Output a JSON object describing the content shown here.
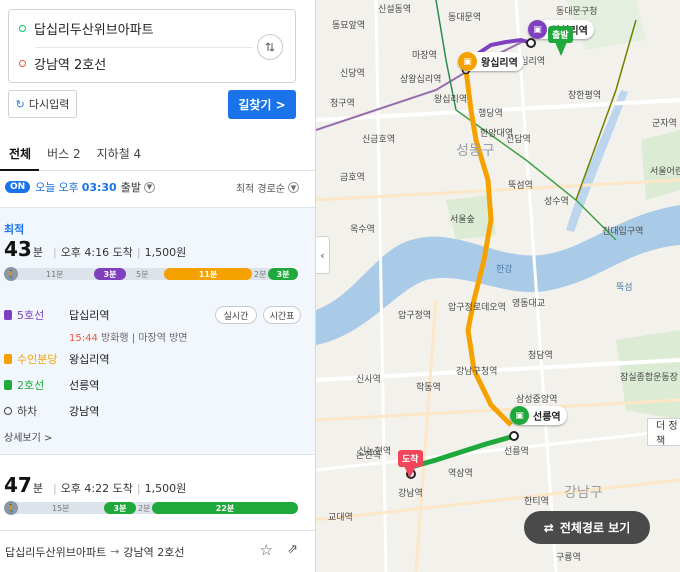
{
  "search": {
    "start": "답십리두산위브아파트",
    "end": "강남역 2호선"
  },
  "actions": {
    "reset_label": "다시입력",
    "go_label": "길찾기 >"
  },
  "tabs": [
    {
      "label": "전체"
    },
    {
      "label": "버스 2"
    },
    {
      "label": "지하철 4"
    }
  ],
  "timebar": {
    "on": "ON",
    "day": "오늘",
    "ampm": "오후",
    "time": "03:30",
    "suffix": "출발",
    "sort": "최적 경로순"
  },
  "route1": {
    "badge": "최적",
    "minutes": "43",
    "unit": "분",
    "arrival": "오후 4:16 도착",
    "fare": "1,500원",
    "segments": {
      "walk1": "11분",
      "bus": "3분",
      "walk2": "5분",
      "subway1": "11분",
      "walk3": "2분",
      "subway2": "3분"
    },
    "steps": [
      {
        "line": "5호선",
        "station": "답십리역"
      },
      {
        "line": "수인분당",
        "station": "왕십리역"
      },
      {
        "line": "2호선",
        "station": "선릉역"
      },
      {
        "line": "하차",
        "station": "강남역"
      }
    ],
    "sub_time": "15:44",
    "sub_info": " 방화행 | 마장역 방면",
    "btn_realtime": "실시간",
    "btn_timetable": "시간표",
    "detail": "상세보기 >"
  },
  "route2": {
    "minutes": "47",
    "unit": "분",
    "arrival": "오후 4:22 도착",
    "fare": "1,500원",
    "segments": {
      "walk1": "15분",
      "seg1": "3분",
      "walk2": "2분",
      "seg2": "22분"
    }
  },
  "footer": {
    "from": "답십리두산위브아파트",
    "arrow": "→",
    "to": "강남역 2호선"
  },
  "map": {
    "labels": {
      "l1": "신설동역",
      "l2": "동묘앞역",
      "l3": "동대문역",
      "l4": "신당역",
      "l5": "청구역",
      "l6": "신금호역",
      "l7": "금호역",
      "l8": "옥수역",
      "l9": "압구정역",
      "l10": "신사역",
      "l11": "논현역",
      "l12": "학동역",
      "l13": "신논현역",
      "l14": "교대역",
      "l15": "성수역",
      "l16": "건대입구역",
      "l17": "뚝섬",
      "l18": "잠실종합운동장",
      "l19": "한티역",
      "l20": "구룡역",
      "l21": "강남구",
      "l22": "선릉역",
      "l23": "강남역",
      "l24": "왕십리역",
      "l25": "답십리역",
      "l26": "한강",
      "l27": "서울숲",
      "l28": "장한평역",
      "l29": "군자역",
      "l30": "행당역",
      "l31": "압구정로데오역",
      "l32": "청담역",
      "l33": "강남구청역",
      "l34": "역삼역",
      "l35": "한양대역",
      "l36": "상왕십리역",
      "l37": "마장역",
      "l38": "성동구",
      "l39": "영동대교",
      "l40": "삼성중앙역",
      "l41": "동대문구청",
      "l42": "신답역",
      "l43": "뚝섬역",
      "l44": "서울어린이대공원"
    },
    "tags": {
      "wangsimni": "왕십리역",
      "dapsimni": "답십리역",
      "seolleung": "선릉역"
    },
    "flags": {
      "start": "출발",
      "arrive": "도착"
    },
    "route_button": "전체경로 보기",
    "side_button": "더 정책"
  }
}
